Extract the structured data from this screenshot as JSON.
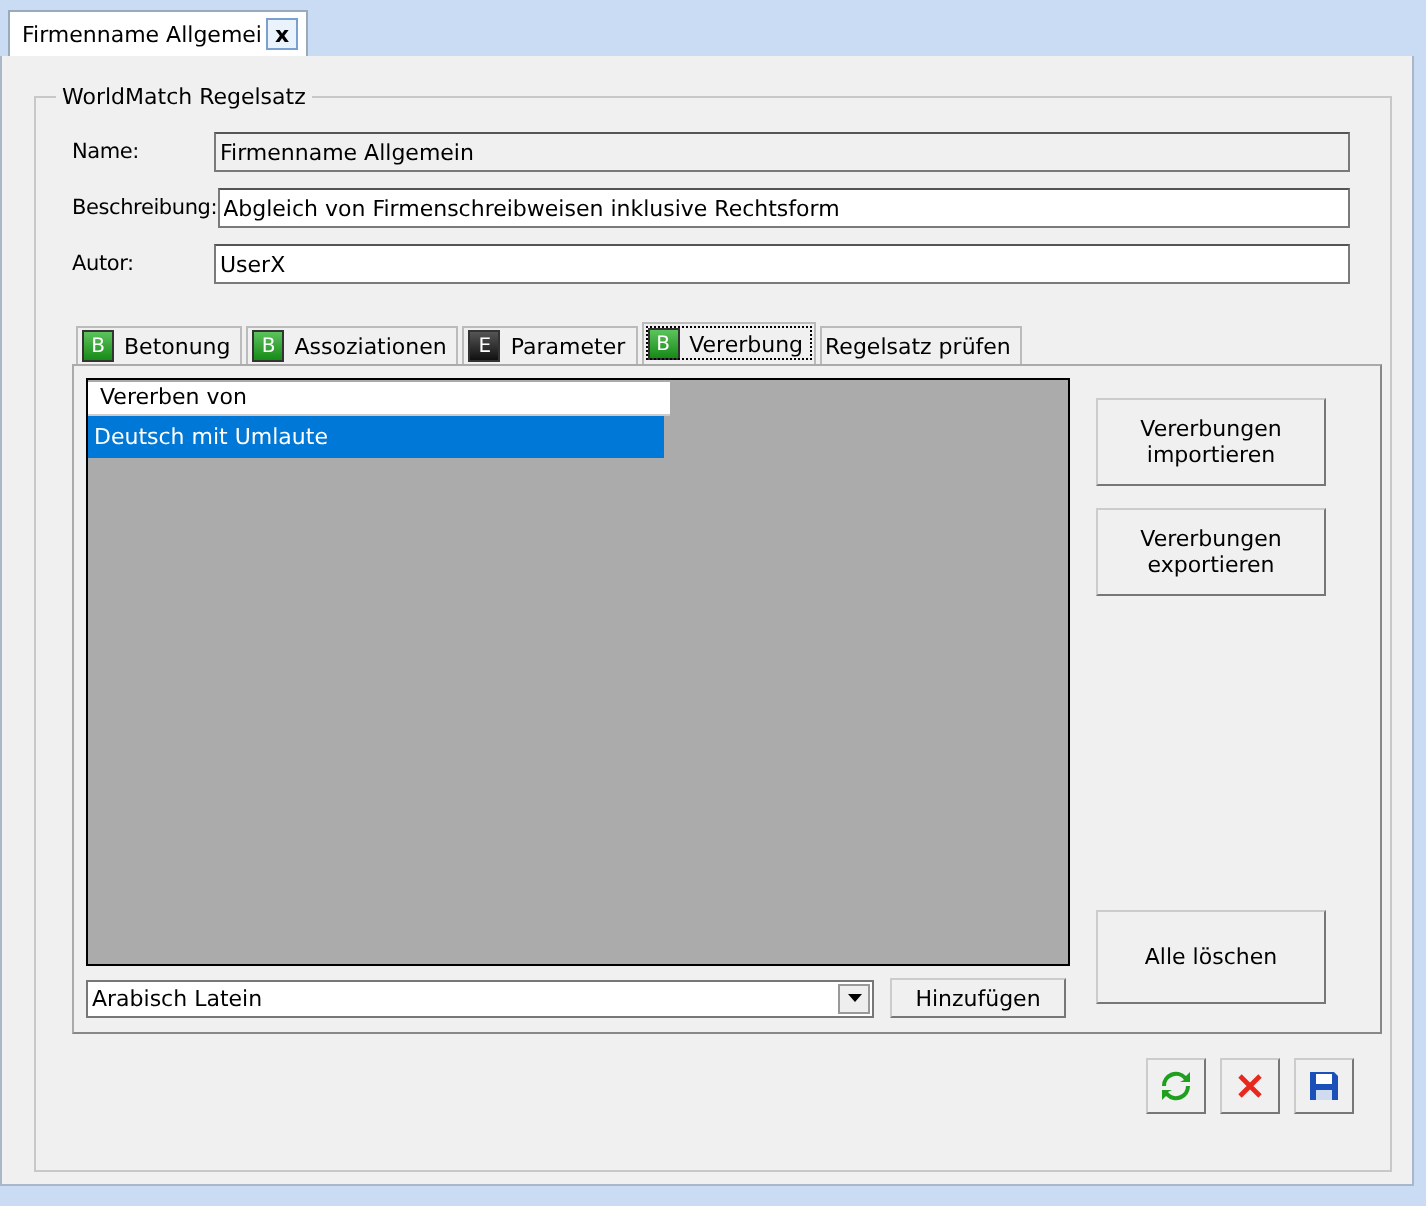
{
  "document_tab": {
    "title": "Firmenname Allgemei",
    "close": "x"
  },
  "group": {
    "title": "WorldMatch Regelsatz"
  },
  "fields": [
    {
      "label": "Name:",
      "value": "Firmenname Allgemein",
      "disabled": true
    },
    {
      "label": "Beschreibung:",
      "value": "Abgleich von Firmenschreibweisen inklusive Rechtsform",
      "disabled": false
    },
    {
      "label": "Autor:",
      "value": "UserX",
      "disabled": false
    }
  ],
  "tabs": [
    {
      "label": "Betonung",
      "badge": "B",
      "kind": "green",
      "selected": false
    },
    {
      "label": "Assoziationen",
      "badge": "B",
      "kind": "green",
      "selected": false
    },
    {
      "label": "Parameter",
      "badge": "E",
      "kind": "black",
      "selected": false
    },
    {
      "label": "Vererbung",
      "badge": "B",
      "kind": "green",
      "selected": true
    },
    {
      "label": "Regelsatz prüfen",
      "kind": "plain",
      "selected": false
    }
  ],
  "table": {
    "columns": [
      "Vererben von"
    ],
    "rows": [
      {
        "cells": [
          "Deutsch mit Umlaute"
        ],
        "selected": true
      }
    ]
  },
  "side_buttons": [
    "Vererbungen importieren",
    "Vererbungen exportieren"
  ],
  "clear_button": "Alle löschen",
  "combo": {
    "value": "Arabisch Latein"
  },
  "add_button": "Hinzufügen",
  "actions": [
    {
      "kind": "refresh"
    },
    {
      "kind": "cancel"
    },
    {
      "kind": "save"
    }
  ]
}
